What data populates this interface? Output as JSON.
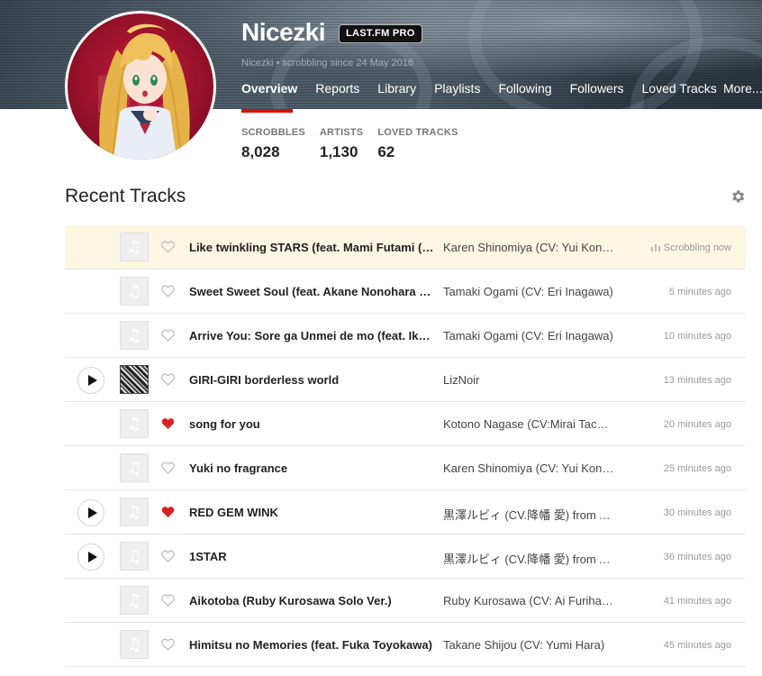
{
  "profile": {
    "name": "Nicezki",
    "badge": "LAST.FM PRO",
    "meta": "Nicezki • scrobbling since 24 May 2016"
  },
  "nav": {
    "items": [
      {
        "label": "Overview",
        "active": true
      },
      {
        "label": "Reports"
      },
      {
        "label": "Library"
      },
      {
        "label": "Playlists"
      },
      {
        "label": "Following"
      },
      {
        "label": "Followers"
      },
      {
        "label": "Loved Tracks"
      }
    ],
    "more": "More..."
  },
  "stats": [
    {
      "label": "Scrobbles",
      "value": "8,028"
    },
    {
      "label": "Artists",
      "value": "1,130"
    },
    {
      "label": "Loved Tracks",
      "value": "62"
    }
  ],
  "recent": {
    "title": "Recent Tracks",
    "tracks": [
      {
        "name": "Like twinkling STARS (feat. Mami Futami (CV: Asami Shimoda))",
        "artist": "Karen Shinomiya (CV: Yui Kondo)",
        "time": "Scrobbling now",
        "loved": false,
        "play": false,
        "cover": "placeholder",
        "now": true
      },
      {
        "name": "Sweet Sweet Soul (feat. Akane Nonohara (CV: Chiyo Ousaki))",
        "artist": "Tamaki Ogami (CV: Eri Inagawa)",
        "time": "5 minutes ago",
        "loved": false,
        "play": false,
        "cover": "placeholder"
      },
      {
        "name": "Arrive You: Sore ga Unmei de mo (feat. Iku Nanao)",
        "artist": "Tamaki Ogami (CV: Eri Inagawa)",
        "time": "10 minutes ago",
        "loved": false,
        "play": false,
        "cover": "placeholder"
      },
      {
        "name": "GIRI-GIRI borderless world",
        "artist": "LizNoir",
        "time": "13 minutes ago",
        "loved": false,
        "play": true,
        "cover": "art"
      },
      {
        "name": "song for you",
        "artist": "Kotono Nagase (CV:Mirai Tachibana)",
        "time": "20 minutes ago",
        "loved": true,
        "play": false,
        "cover": "placeholder"
      },
      {
        "name": "Yuki no fragrance",
        "artist": "Karen Shinomiya (CV: Yui Kondo)",
        "time": "25 minutes ago",
        "loved": false,
        "play": false,
        "cover": "placeholder"
      },
      {
        "name": "RED GEM WINK",
        "artist": "黒澤ルビィ (CV.降幡 愛) from Aqours",
        "time": "30 minutes ago",
        "loved": true,
        "play": true,
        "cover": "placeholder"
      },
      {
        "name": "1STAR",
        "artist": "黒澤ルビィ (CV.降幡 愛) from Aqours",
        "time": "36 minutes ago",
        "loved": false,
        "play": true,
        "cover": "placeholder"
      },
      {
        "name": "Aikotoba (Ruby Kurosawa Solo Ver.)",
        "artist": "Ruby Kurosawa (CV: Ai Furihata)",
        "time": "41 minutes ago",
        "loved": false,
        "play": false,
        "cover": "placeholder"
      },
      {
        "name": "Himitsu no Memories (feat. Fuka Toyokawa)",
        "artist": "Takane Shijou (CV: Yumi Hara)",
        "time": "45 minutes ago",
        "loved": false,
        "play": false,
        "cover": "placeholder"
      }
    ]
  },
  "colors": {
    "accent": "#d51007",
    "now_playing_bg": "#fcf6e2",
    "loved": "#d92323"
  },
  "icons": {
    "settings": "gear-icon",
    "love": "heart-icon",
    "play": "play-icon",
    "cover_placeholder": "music-note-icon",
    "now_playing": "equalizer-icon"
  }
}
